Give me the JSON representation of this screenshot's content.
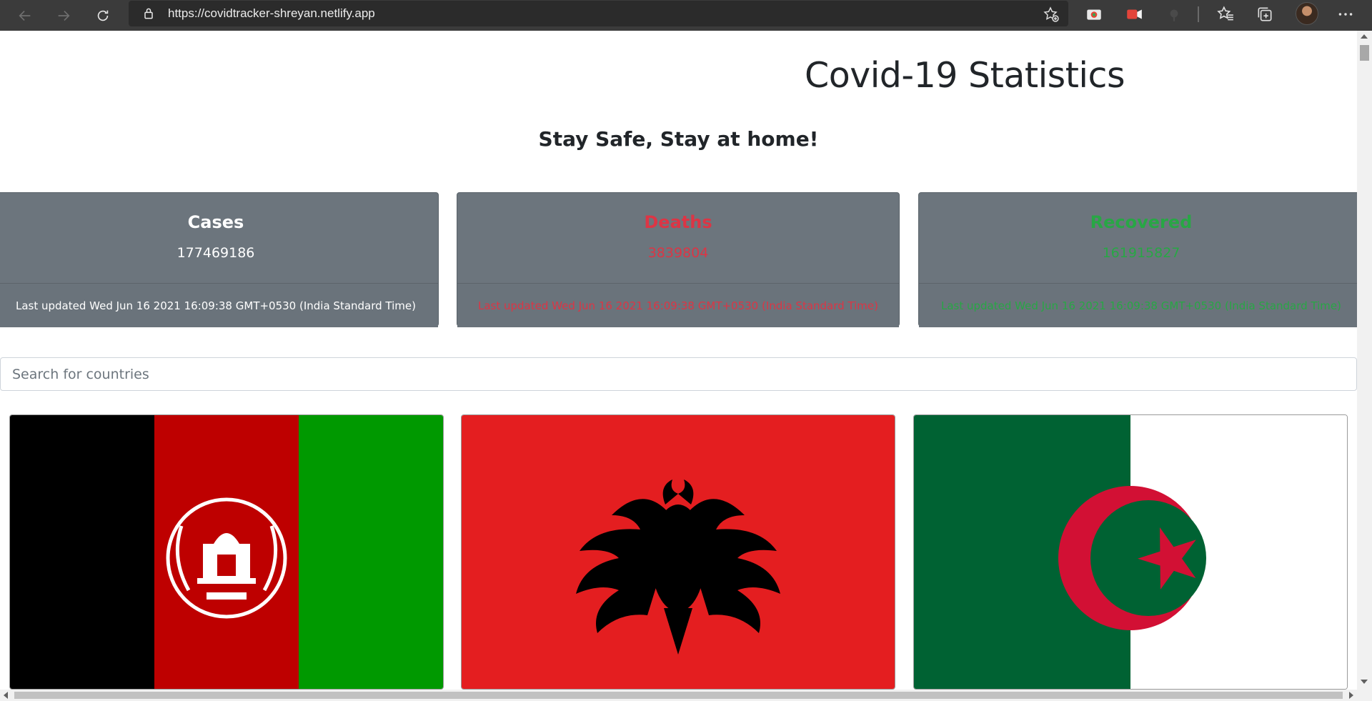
{
  "browser": {
    "url": "https://covidtracker-shreyan.netlify.app",
    "icons": [
      "back-icon",
      "forward-icon",
      "reload-icon",
      "lock-icon",
      "add-favorite-icon",
      "extension-icon",
      "record-icon",
      "tracker-icon",
      "favorites-icon",
      "collections-icon",
      "profile-avatar",
      "more-icon"
    ]
  },
  "page": {
    "title": "Covid-19 Statistics",
    "subtitle": "Stay Safe, Stay at home!"
  },
  "stats": {
    "cases": {
      "title": "Cases",
      "value": "177469186",
      "updated": "Last updated Wed Jun 16 2021 16:09:38 GMT+0530 (India Standard Time)",
      "color": "#ffffff"
    },
    "deaths": {
      "title": "Deaths",
      "value": "3839804",
      "updated": "Last updated Wed Jun 16 2021 16:09:38 GMT+0530 (India Standard Time)",
      "color": "#dc3545"
    },
    "recovered": {
      "title": "Recovered",
      "value": "161915827",
      "updated": "Last updated Wed Jun 16 2021 16:09:38 GMT+0530 (India Standard Time)",
      "color": "#28a745"
    }
  },
  "search": {
    "placeholder": "Search for countries"
  },
  "countries": [
    {
      "flag": "afghanistan-flag"
    },
    {
      "flag": "albania-flag"
    },
    {
      "flag": "algeria-flag"
    }
  ],
  "colors": {
    "card_bg": "#6c757d",
    "text": "#212529",
    "browser_bar": "#3b3b3b"
  }
}
